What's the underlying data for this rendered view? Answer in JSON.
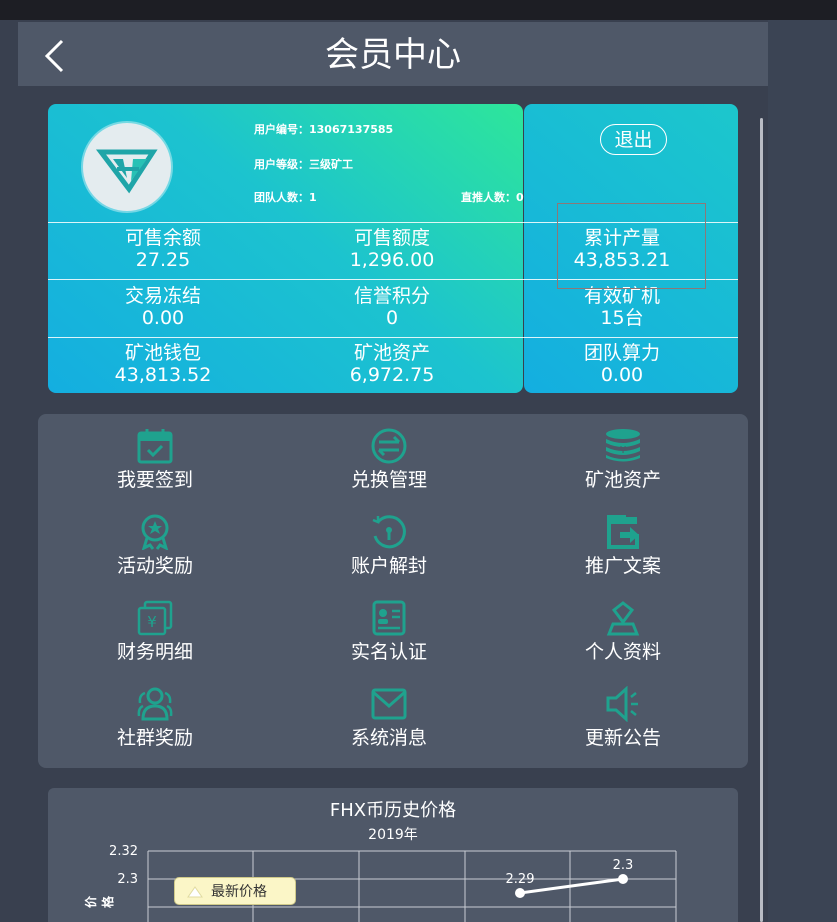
{
  "header": {
    "title": "会员中心"
  },
  "user": {
    "id_label": "用户编号：",
    "id_value": "13067137585",
    "level_label": "用户等级：",
    "level_value": "三级矿工",
    "team_label": "团队人数：",
    "team_value": "1",
    "direct_label": "直推人数：",
    "direct_value": "0",
    "logout_label": "退出"
  },
  "stats": [
    {
      "label": "可售余额",
      "value": "27.25"
    },
    {
      "label": "可售额度",
      "value": "1,296.00"
    },
    {
      "label": "累计产量",
      "value": "43,853.21"
    },
    {
      "label": "交易冻结",
      "value": "0.00"
    },
    {
      "label": "信誉积分",
      "value": "0"
    },
    {
      "label": "有效矿机",
      "value": "15台"
    },
    {
      "label": "矿池钱包",
      "value": "43,813.52"
    },
    {
      "label": "矿池资产",
      "value": "6,972.75"
    },
    {
      "label": "团队算力",
      "value": "0.00"
    }
  ],
  "menu": [
    {
      "label": "我要签到",
      "icon": "calendar-check-icon"
    },
    {
      "label": "兑换管理",
      "icon": "exchange-icon"
    },
    {
      "label": "矿池资产",
      "icon": "coin-stack-icon"
    },
    {
      "label": "活动奖励",
      "icon": "award-icon"
    },
    {
      "label": "账户解封",
      "icon": "unlock-icon"
    },
    {
      "label": "推广文案",
      "icon": "share-icon"
    },
    {
      "label": "财务明细",
      "icon": "finance-icon"
    },
    {
      "label": "实名认证",
      "icon": "id-card-icon"
    },
    {
      "label": "个人资料",
      "icon": "user-icon"
    },
    {
      "label": "社群奖励",
      "icon": "group-icon"
    },
    {
      "label": "系统消息",
      "icon": "mail-icon"
    },
    {
      "label": "更新公告",
      "icon": "megaphone-icon"
    }
  ],
  "chart": {
    "title": "FHX币历史价格",
    "subtitle": "2019年",
    "legend": "最新价格",
    "ylabel": "价格"
  },
  "colors": {
    "accent": "#1fa28e",
    "card_start": "#14aee0",
    "card_end": "#2ee69a",
    "panel": "#4f5868"
  },
  "chart_data": {
    "type": "line",
    "title": "FHX币历史价格",
    "subtitle": "2019年",
    "ylabel": "价格",
    "series": [
      {
        "name": "最新价格",
        "values": [
          2.29,
          2.3
        ]
      }
    ],
    "yticks": [
      2.32,
      2.3
    ],
    "ylim": [
      2.28,
      2.32
    ],
    "grid": true,
    "legend": "top-left"
  }
}
